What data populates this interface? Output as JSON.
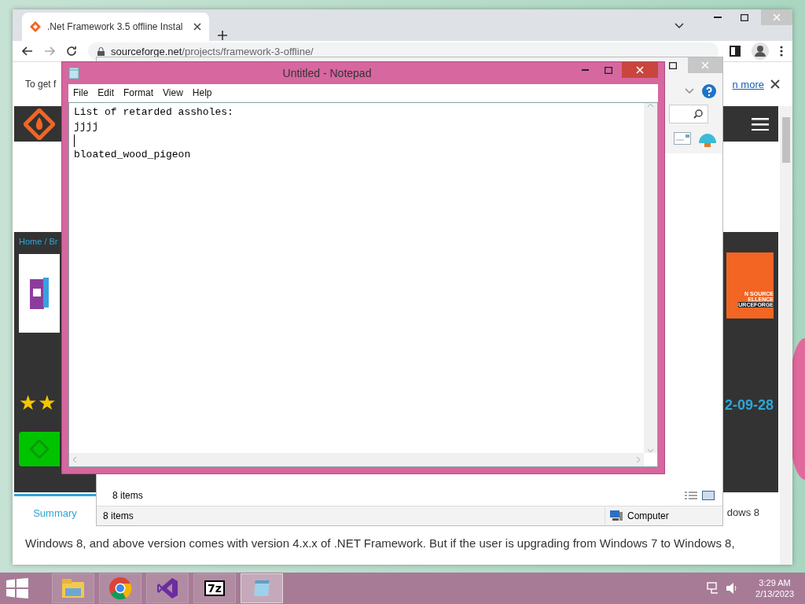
{
  "browser": {
    "tab": {
      "title": ".Net Framework 3.5 offline Instal",
      "selected": true
    },
    "address": {
      "domain": "sourceforge.net",
      "path": "/projects/framework-3-offline/"
    },
    "banner": {
      "text": "To get f",
      "link": "n more"
    },
    "page": {
      "breadcrumb": "Home / Br",
      "star_glyphs": "★★",
      "badge_lines": [
        "N SOURCE",
        "ELLENCE",
        "URCEFORGE"
      ],
      "date": "2-09-28",
      "tabs": [
        {
          "label": "Summary",
          "selected": true
        }
      ],
      "side_text": "dows 8",
      "paragraph": "Windows 8, and above version comes with version 4.x.x of .NET Framework. But if the user is upgrading from Windows 7 to Windows 8,"
    }
  },
  "explorer": {
    "item_count": "8 items",
    "status": "8 items",
    "location": "Computer"
  },
  "notepad": {
    "title": "Untitled - Notepad",
    "menu": [
      "File",
      "Edit",
      "Format",
      "View",
      "Help"
    ],
    "lines": [
      {
        "text": "List of retarded assholes:",
        "caret": false
      },
      {
        "text": "jjjj",
        "caret": false
      },
      {
        "caret": true
      },
      {
        "text": "bloated_wood_pigeon",
        "caret": false
      }
    ]
  },
  "taskbar": {
    "apps": [
      {
        "kind": "folder",
        "selected": false
      },
      {
        "kind": "chrome",
        "selected": false
      },
      {
        "kind": "studio",
        "selected": false
      },
      {
        "kind": "archiver",
        "label": "7z",
        "selected": false
      },
      {
        "kind": "notepad",
        "selected": true
      }
    ],
    "time": "3:29 AM",
    "date": "2/13/2023"
  }
}
